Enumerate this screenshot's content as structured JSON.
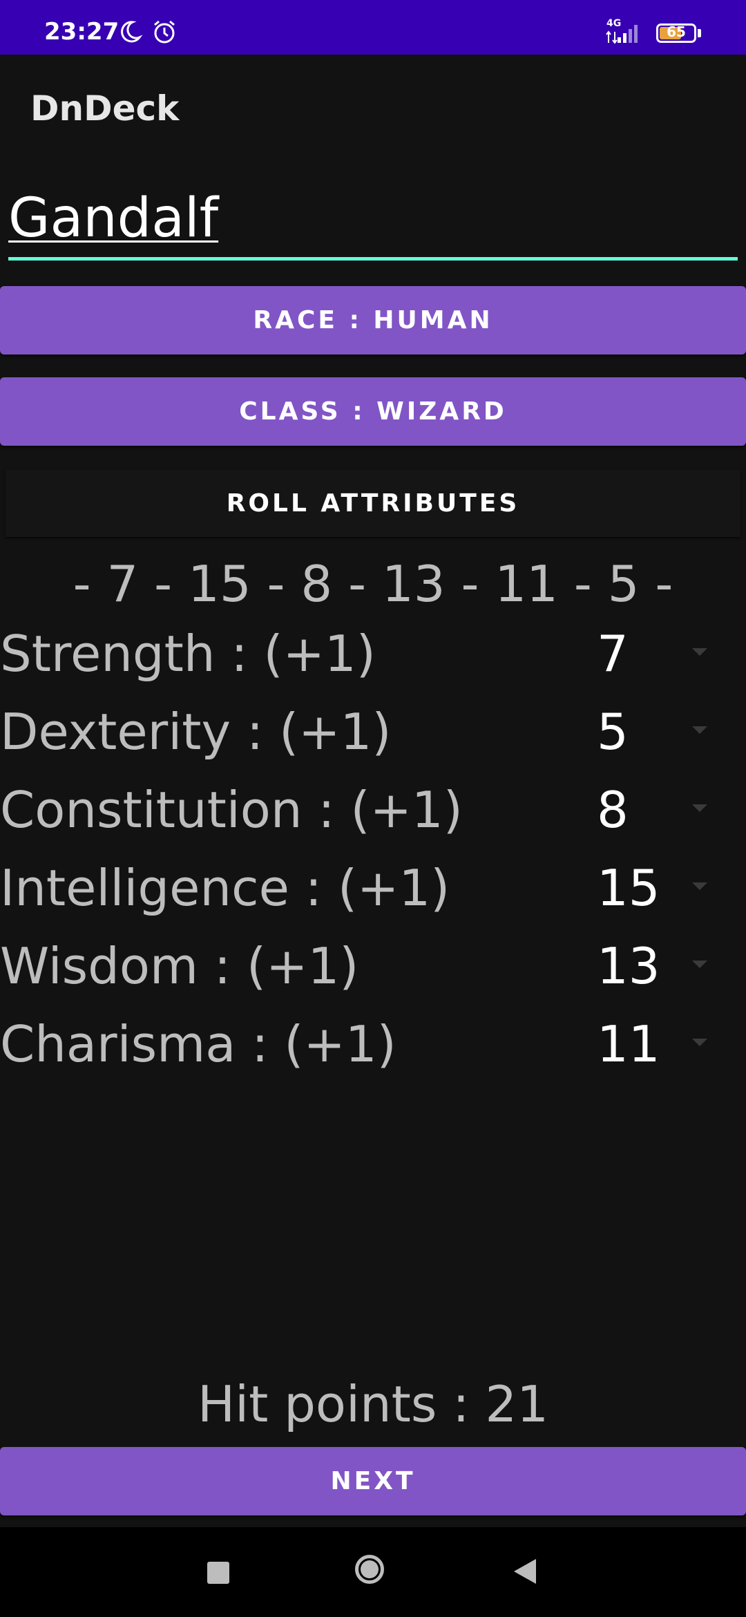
{
  "status_bar": {
    "time": "23:27",
    "network": "4G",
    "battery": "65",
    "battery_level": 0.65,
    "icons": [
      "moon-icon",
      "alarm-icon",
      "signal-icon",
      "battery-icon"
    ]
  },
  "app_bar": {
    "title": "DnDeck"
  },
  "character": {
    "name": "Gandalf"
  },
  "buttons": {
    "race": "RACE : HUMAN",
    "class": "CLASS : WIZARD",
    "roll": "ROLL ATTRIBUTES",
    "next": "NEXT"
  },
  "rolled_values": "- 7 - 15 - 8 - 13 - 11 - 5 -",
  "attributes": [
    {
      "label": "Strength : (+1)",
      "value": "7"
    },
    {
      "label": "Dexterity : (+1)",
      "value": "5"
    },
    {
      "label": "Constitution : (+1)",
      "value": "8"
    },
    {
      "label": "Intelligence : (+1)",
      "value": "15"
    },
    {
      "label": "Wisdom : (+1)",
      "value": "13"
    },
    {
      "label": "Charisma : (+1)",
      "value": "11"
    }
  ],
  "hit_points": "Hit points : 21",
  "colors": {
    "status_bar": "#3700b3",
    "background": "#121212",
    "button": "#8155c6",
    "accent": "#64ffda"
  }
}
